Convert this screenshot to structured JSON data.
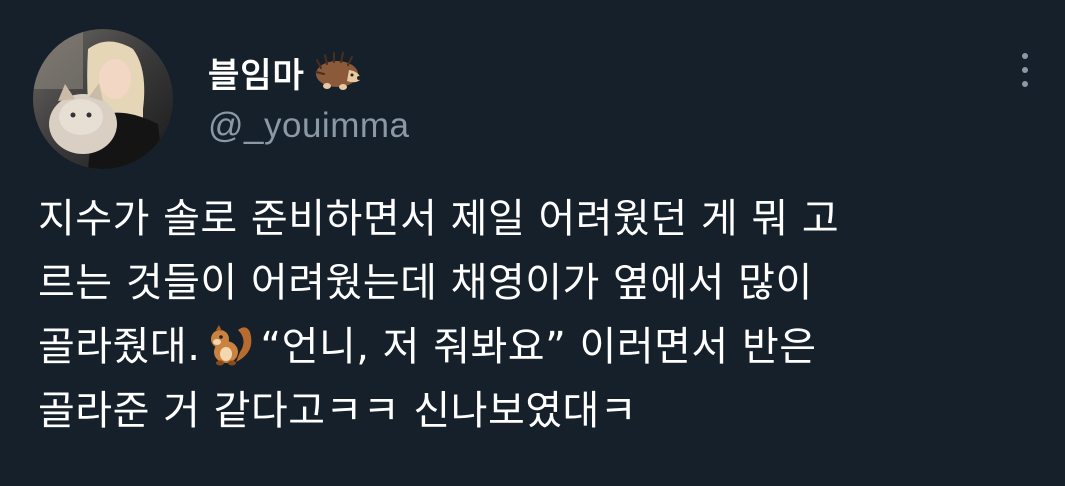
{
  "tweet": {
    "author": {
      "display_name": "블임마",
      "name_emoji": "hedgehog",
      "handle": "@_youimma",
      "avatar": "profile photo of person holding a cat"
    },
    "menu_icon": "more-vertical-icon",
    "text": {
      "line1": "지수가 솔로 준비하면서 제일 어려웠던 게 뭐 고",
      "line2": "르는 것들이 어려웠는데 채영이가 옆에서 많이",
      "line3_before_emoji": "골라줬대.",
      "line3_emoji": "chipmunk",
      "line3_after_emoji": "“언니, 저 줘봐요” 이러면서 반은",
      "line4": "골라준 거 같다고ㅋㅋ 신나보였대ㅋ"
    }
  },
  "colors": {
    "background": "#15202b",
    "primary_text": "#ffffff",
    "secondary_text": "#8b98a5"
  }
}
